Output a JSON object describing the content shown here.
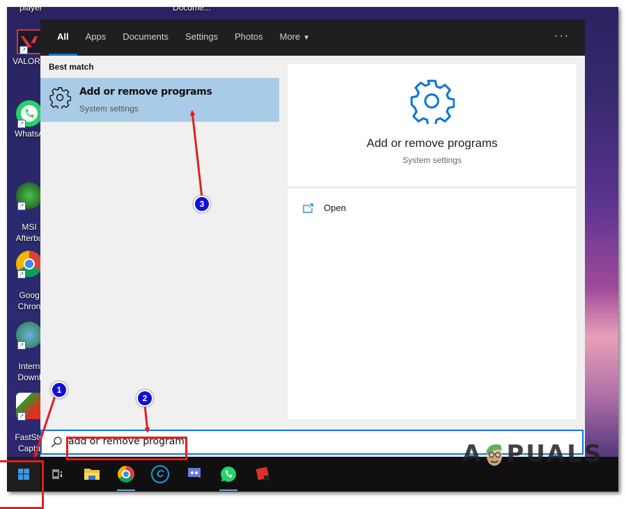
{
  "desktop": {
    "top_labels": [
      "player",
      "Docume..."
    ],
    "icons": [
      {
        "name": "valorant",
        "label": "VALORA",
        "color": "#e0303a"
      },
      {
        "name": "whatsapp",
        "label": "WhatsA",
        "color": "#25d366"
      },
      {
        "name": "msi-afterburner",
        "label": "MSI\nAfterbu",
        "color": "#2a8a2a"
      },
      {
        "name": "google-chrome",
        "label": "Goog\nChron",
        "color": "#dd4433"
      },
      {
        "name": "internet-download-manager",
        "label": "Intern\nDownl",
        "color": "#3a9a3a"
      },
      {
        "name": "faststone-capture",
        "label": "FastSto\nCaptu",
        "color": "#c03020"
      }
    ]
  },
  "search": {
    "tabs": [
      {
        "label": "All",
        "active": true
      },
      {
        "label": "Apps",
        "active": false
      },
      {
        "label": "Documents",
        "active": false
      },
      {
        "label": "Settings",
        "active": false
      },
      {
        "label": "Photos",
        "active": false
      },
      {
        "label": "More",
        "active": false,
        "dropdown": true
      }
    ],
    "more_options_label": "···",
    "best_match_label": "Best match",
    "best_match": {
      "title": "Add or remove programs",
      "subtitle": "System settings",
      "icon": "gear-icon"
    },
    "preview": {
      "title": "Add or remove programs",
      "subtitle": "System settings",
      "icon": "gear-icon"
    },
    "actions": [
      {
        "label": "Open",
        "icon": "open-window-icon"
      }
    ],
    "query": "add or remove programs",
    "accent_color": "#0a78d7"
  },
  "taskbar": {
    "start_icon": "windows-logo-icon",
    "items": [
      {
        "name": "task-view",
        "running": false
      },
      {
        "name": "file-explorer",
        "running": false
      },
      {
        "name": "google-chrome",
        "running": true
      },
      {
        "name": "ccleaner",
        "running": false
      },
      {
        "name": "discord",
        "running": false
      },
      {
        "name": "whatsapp",
        "running": true
      },
      {
        "name": "roblox",
        "running": false
      }
    ]
  },
  "annotations": {
    "steps": [
      "1",
      "2",
      "3"
    ],
    "highlight_color": "#e41d1d",
    "badge_color": "#1010d8"
  },
  "watermark": {
    "text_left": "A",
    "text_right": "PUALS"
  }
}
